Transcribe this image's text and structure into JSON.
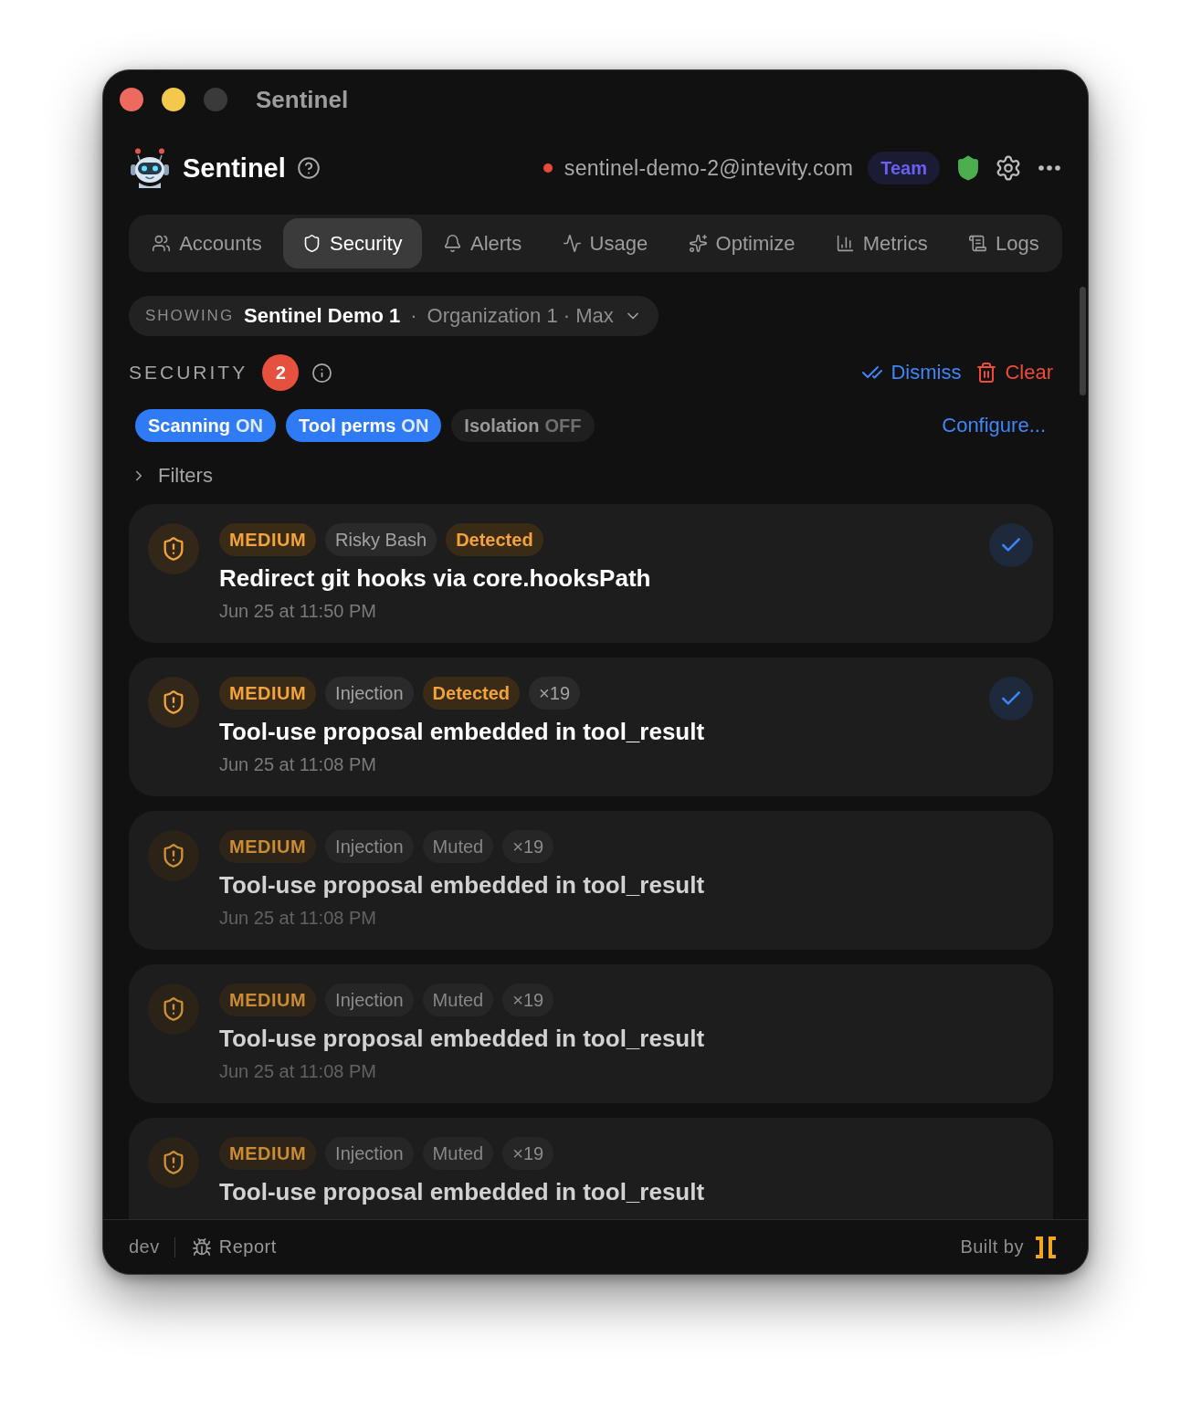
{
  "window": {
    "title": "Sentinel",
    "controls": [
      {
        "kind": "close",
        "disabled": false
      },
      {
        "kind": "minimize",
        "disabled": false
      },
      {
        "kind": "zoom",
        "disabled": true
      }
    ]
  },
  "header": {
    "app_name": "Sentinel",
    "email": "sentinel-demo-2@intevity.com",
    "plan": "Team"
  },
  "tabs": [
    {
      "label": "Accounts",
      "selected": false
    },
    {
      "label": "Security",
      "selected": true
    },
    {
      "label": "Alerts",
      "selected": false
    },
    {
      "label": "Usage",
      "selected": false
    },
    {
      "label": "Optimize",
      "selected": false
    },
    {
      "label": "Metrics",
      "selected": false
    },
    {
      "label": "Logs",
      "selected": false
    }
  ],
  "scope": {
    "label": "SHOWING",
    "name": "Sentinel Demo 1",
    "separator": "·",
    "detail": "Organization 1 · Max"
  },
  "security": {
    "heading": "SECURITY",
    "count": "2",
    "actions": [
      {
        "kind": "dismiss",
        "label": "Dismiss"
      },
      {
        "kind": "clear",
        "label": "Clear"
      }
    ]
  },
  "toggles": [
    {
      "label": "Scanning",
      "value": "ON",
      "on": true
    },
    {
      "label": "Tool perms",
      "value": "ON",
      "on": true
    },
    {
      "label": "Isolation",
      "value": "OFF",
      "on": false
    }
  ],
  "configure_link": "Configure...",
  "filters": {
    "label": "Filters",
    "expanded": false
  },
  "alerts": [
    {
      "severity": "MEDIUM",
      "category": "Risky Bash",
      "status": "Detected",
      "muted": false,
      "title": "Redirect git hooks via core.hooksPath",
      "time": "Jun 25 at 11:50 PM"
    },
    {
      "severity": "MEDIUM",
      "category": "Injection",
      "status": "Detected",
      "count": "×19",
      "muted": false,
      "title": "Tool-use proposal embedded in tool_result",
      "time": "Jun 25 at 11:08 PM"
    },
    {
      "severity": "MEDIUM",
      "category": "Injection",
      "status": "Muted",
      "count": "×19",
      "muted": true,
      "title": "Tool-use proposal embedded in tool_result",
      "time": "Jun 25 at 11:08 PM"
    },
    {
      "severity": "MEDIUM",
      "category": "Injection",
      "status": "Muted",
      "count": "×19",
      "muted": true,
      "title": "Tool-use proposal embedded in tool_result",
      "time": "Jun 25 at 11:08 PM"
    },
    {
      "severity": "MEDIUM",
      "category": "Injection",
      "status": "Muted",
      "count": "×19",
      "muted": true,
      "title": "Tool-use proposal embedded in tool_result"
    }
  ],
  "footer": {
    "env": "dev",
    "report": "Report",
    "built_by": "Built by"
  }
}
